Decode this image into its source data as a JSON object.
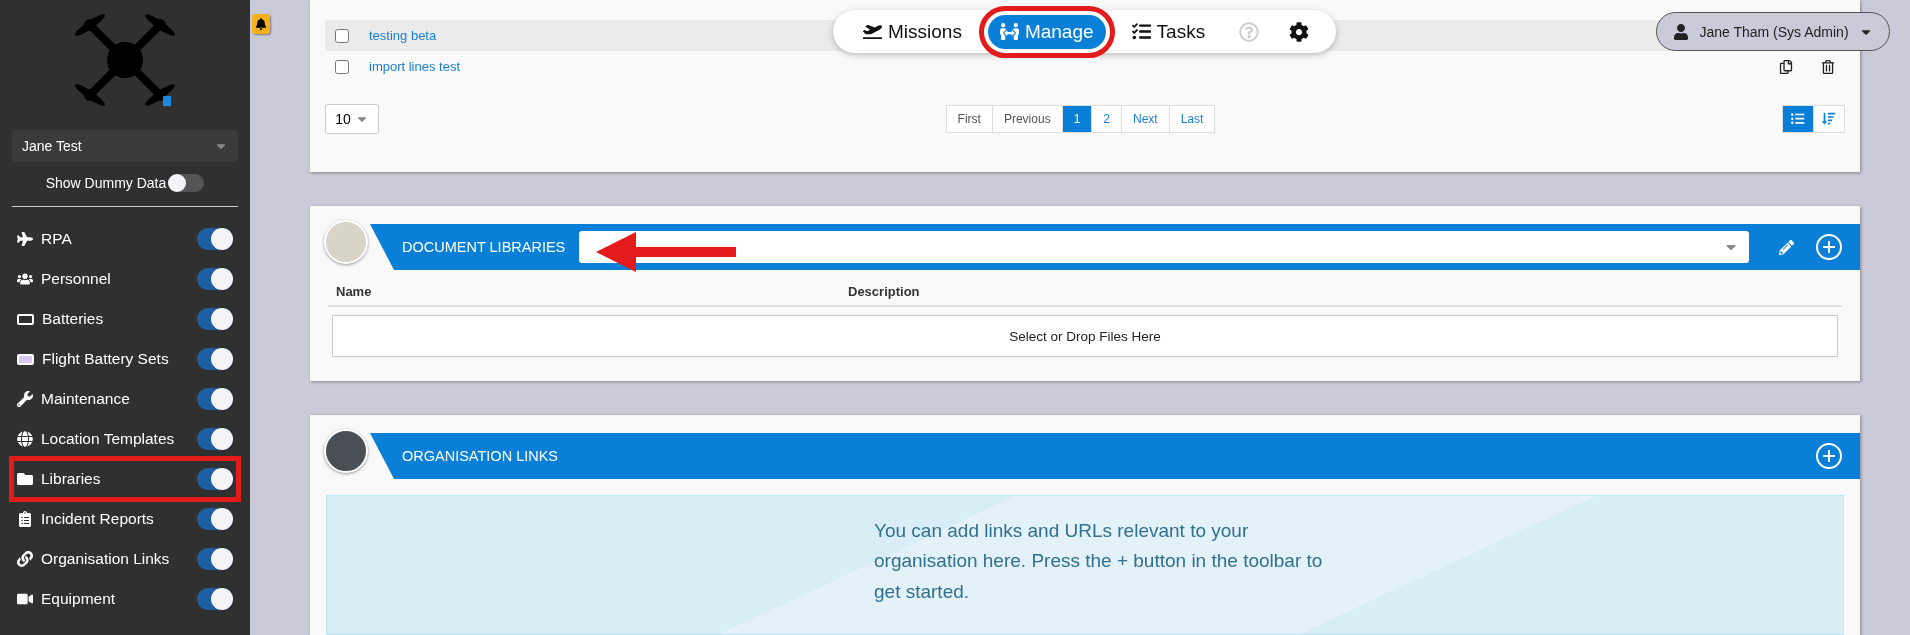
{
  "sidebar": {
    "account": "Jane Test",
    "dummy_data": {
      "label": "Show Dummy Data",
      "on": false
    },
    "items": [
      {
        "label": "RPA",
        "on": true,
        "highlighted": false
      },
      {
        "label": "Personnel",
        "on": true,
        "highlighted": false
      },
      {
        "label": "Batteries",
        "on": true,
        "highlighted": false
      },
      {
        "label": "Flight Battery Sets",
        "on": true,
        "highlighted": false
      },
      {
        "label": "Maintenance",
        "on": true,
        "highlighted": false
      },
      {
        "label": "Location Templates",
        "on": true,
        "highlighted": false
      },
      {
        "label": "Libraries",
        "on": true,
        "highlighted": true
      },
      {
        "label": "Incident Reports",
        "on": true,
        "highlighted": false
      },
      {
        "label": "Organisation Links",
        "on": true,
        "highlighted": false
      },
      {
        "label": "Equipment",
        "on": true,
        "highlighted": false
      }
    ]
  },
  "nav": [
    {
      "label": "Missions",
      "selected": false,
      "highlighted": false
    },
    {
      "label": "Manage",
      "selected": true,
      "highlighted": true
    },
    {
      "label": "Tasks",
      "selected": false,
      "highlighted": false
    }
  ],
  "user": "Jane Tham (Sys Admin)",
  "list": {
    "rows": [
      {
        "label": "testing beta",
        "checked": false,
        "hovered": true
      },
      {
        "label": "import lines test",
        "checked": false,
        "hovered": false
      }
    ],
    "page_size": "10",
    "pagination": [
      {
        "label": "First",
        "selected": false
      },
      {
        "label": "Previous",
        "selected": false
      },
      {
        "label": "1",
        "selected": true
      },
      {
        "label": "2",
        "selected": false
      },
      {
        "label": "Next",
        "selected": false
      },
      {
        "label": "Last",
        "selected": false
      }
    ]
  },
  "document_libraries": {
    "title": "DOCUMENT LIBRARIES",
    "columns": [
      "Name",
      "Description"
    ],
    "dropzone": "Select or Drop Files Here"
  },
  "organisation_links": {
    "title": "ORGANISATION LINKS",
    "message": "You can add links and URLs relevant to your organisation here. Press the + button in the toolbar to get started."
  }
}
